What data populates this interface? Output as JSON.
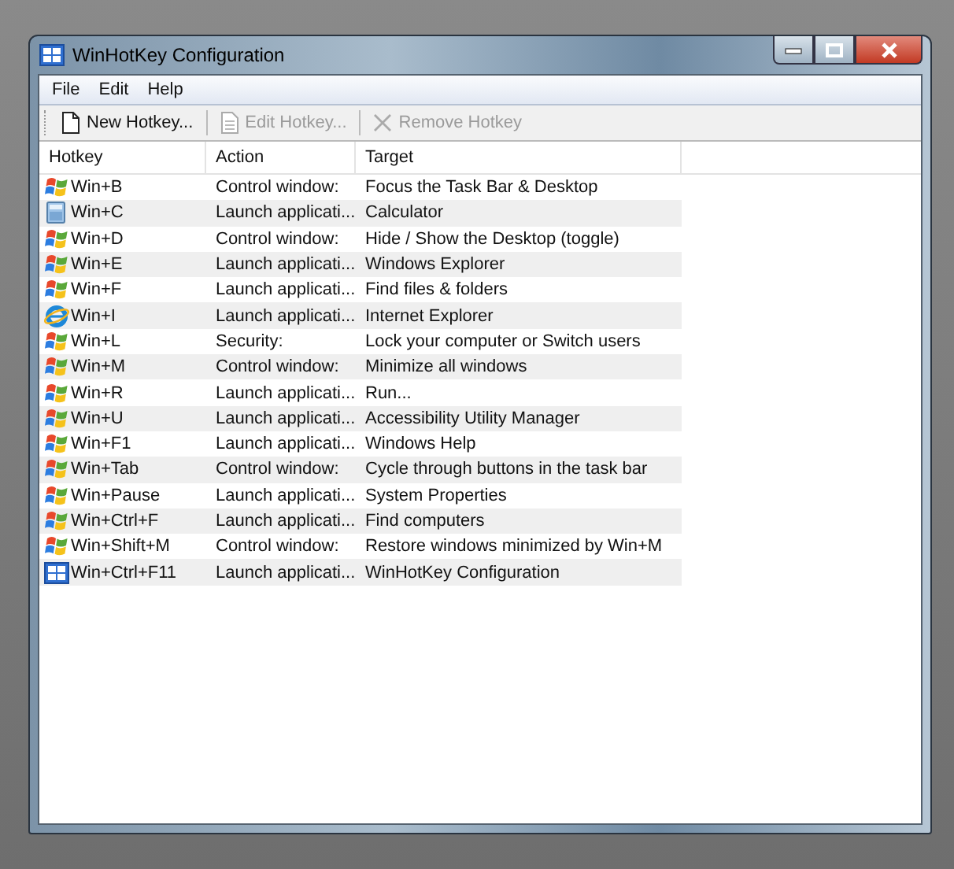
{
  "window": {
    "title": "WinHotKey Configuration"
  },
  "menu": [
    {
      "label": "File"
    },
    {
      "label": "Edit"
    },
    {
      "label": "Help"
    }
  ],
  "toolbar": [
    {
      "label": "New Hotkey...",
      "kind": "page",
      "disabled": false
    },
    {
      "label": "Edit Hotkey...",
      "kind": "edit",
      "disabled": true
    },
    {
      "label": "Remove Hotkey",
      "kind": "remove",
      "disabled": true
    }
  ],
  "table": {
    "columns": [
      "Hotkey",
      "Action",
      "Target"
    ],
    "rows": [
      {
        "kind": "windows",
        "hotkey": "Win+B",
        "action": "Control window:",
        "target": "Focus the Task Bar & Desktop"
      },
      {
        "kind": "calculator",
        "hotkey": "Win+C",
        "action": "Launch applicati...",
        "target": "Calculator"
      },
      {
        "kind": "windows",
        "hotkey": "Win+D",
        "action": "Control window:",
        "target": "Hide / Show the Desktop (toggle)"
      },
      {
        "kind": "windows",
        "hotkey": "Win+E",
        "action": "Launch applicati...",
        "target": "Windows Explorer"
      },
      {
        "kind": "windows",
        "hotkey": "Win+F",
        "action": "Launch applicati...",
        "target": "Find files & folders"
      },
      {
        "kind": "ie",
        "hotkey": "Win+I",
        "action": "Launch applicati...",
        "target": "Internet Explorer"
      },
      {
        "kind": "windows",
        "hotkey": "Win+L",
        "action": "Security:",
        "target": "Lock your computer or Switch users"
      },
      {
        "kind": "windows",
        "hotkey": "Win+M",
        "action": "Control window:",
        "target": "Minimize all windows"
      },
      {
        "kind": "windows",
        "hotkey": "Win+R",
        "action": "Launch applicati...",
        "target": "Run..."
      },
      {
        "kind": "windows",
        "hotkey": "Win+U",
        "action": "Launch applicati...",
        "target": "Accessibility Utility Manager"
      },
      {
        "kind": "windows",
        "hotkey": "Win+F1",
        "action": "Launch applicati...",
        "target": "Windows Help"
      },
      {
        "kind": "windows",
        "hotkey": "Win+Tab",
        "action": "Control window:",
        "target": "Cycle through buttons in the task bar"
      },
      {
        "kind": "windows",
        "hotkey": "Win+Pause",
        "action": "Launch applicati...",
        "target": "System Properties"
      },
      {
        "kind": "windows",
        "hotkey": "Win+Ctrl+F",
        "action": "Launch applicati...",
        "target": "Find computers"
      },
      {
        "kind": "windows",
        "hotkey": "Win+Shift+M",
        "action": "Control window:",
        "target": "Restore windows minimized by Win+M"
      },
      {
        "kind": "app",
        "hotkey": "Win+Ctrl+F11",
        "action": "Launch applicati...",
        "target": "WinHotKey Configuration"
      }
    ]
  }
}
